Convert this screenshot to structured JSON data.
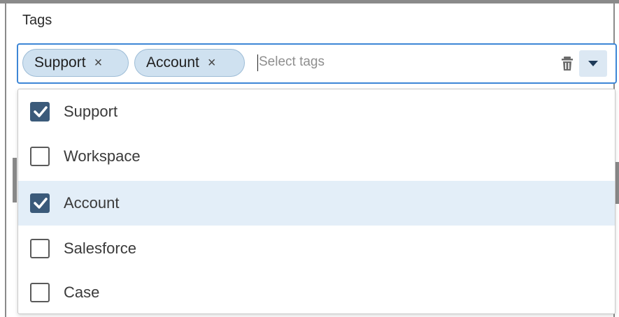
{
  "field": {
    "label": "Tags",
    "placeholder": "Select tags"
  },
  "selected_tags": [
    {
      "label": "Support",
      "remove": "×"
    },
    {
      "label": "Account",
      "remove": "×"
    }
  ],
  "options": [
    {
      "label": "Support",
      "checked": true,
      "highlighted": false
    },
    {
      "label": "Workspace",
      "checked": false,
      "highlighted": false
    },
    {
      "label": "Account",
      "checked": true,
      "highlighted": true
    },
    {
      "label": "Salesforce",
      "checked": false,
      "highlighted": false
    },
    {
      "label": "Case",
      "checked": false,
      "highlighted": false
    }
  ],
  "icons": {
    "clear": "trash-icon",
    "toggle": "triangle-down-icon",
    "check": "checkmark-icon"
  },
  "colors": {
    "focus_border": "#3d86d6",
    "chip_bg": "#cfe1f0",
    "checkbox_checked": "#3b5a7a",
    "highlight_row": "#e3eef8"
  }
}
